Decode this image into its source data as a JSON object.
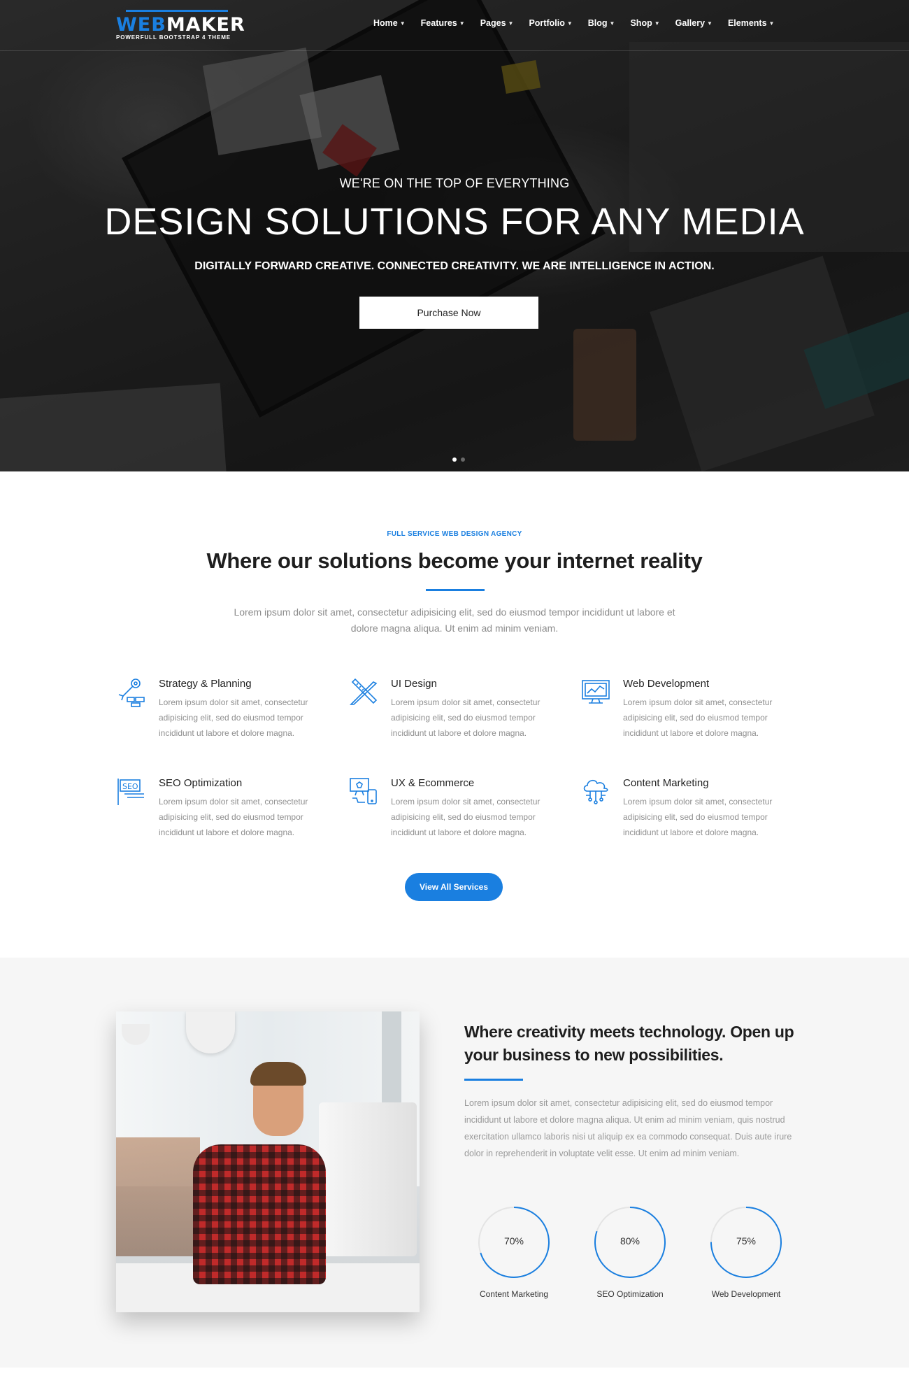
{
  "brand": {
    "name_part1": "WEB",
    "name_part2": "MAKER",
    "tagline": "POWERFULL BOOTSTRAP 4 THEME",
    "accent_color": "#1a7fe0"
  },
  "nav": {
    "items": [
      {
        "label": "Home"
      },
      {
        "label": "Features"
      },
      {
        "label": "Pages"
      },
      {
        "label": "Portfolio"
      },
      {
        "label": "Blog"
      },
      {
        "label": "Shop"
      },
      {
        "label": "Gallery"
      },
      {
        "label": "Elements"
      }
    ],
    "caret_icon": "chevron-down-icon"
  },
  "hero": {
    "kicker": "WE'RE ON THE TOP OF EVERYTHING",
    "title": "DESIGN SOLUTIONS FOR ANY MEDIA",
    "subtitle": "DIGITALLY FORWARD CREATIVE. CONNECTED CREATIVITY. WE ARE INTELLIGENCE IN ACTION.",
    "cta_label": "Purchase Now",
    "slides": 2,
    "active_slide": 1
  },
  "services": {
    "eyebrow": "FULL SERVICE WEB DESIGN AGENCY",
    "title": "Where our solutions become your internet reality",
    "lede": "Lorem ipsum dolor sit amet, consectetur adipisicing elit, sed do eiusmod tempor incididunt ut labore et dolore magna aliqua. Ut enim ad minim veniam.",
    "items": [
      {
        "title": "Strategy & Planning",
        "icon": "strategy-icon",
        "desc": "Lorem ipsum dolor sit amet, consectetur adipisicing elit, sed do eiusmod tempor incididunt ut labore et dolore magna."
      },
      {
        "title": "UI Design",
        "icon": "ui-design-icon",
        "desc": "Lorem ipsum dolor sit amet, consectetur adipisicing elit, sed do eiusmod tempor incididunt ut labore et dolore magna."
      },
      {
        "title": "Web Development",
        "icon": "web-development-icon",
        "desc": "Lorem ipsum dolor sit amet, consectetur adipisicing elit, sed do eiusmod tempor incididunt ut labore et dolore magna."
      },
      {
        "title": "SEO Optimization",
        "icon": "seo-icon",
        "desc": "Lorem ipsum dolor sit amet, consectetur adipisicing elit, sed do eiusmod tempor incididunt ut labore et dolore magna."
      },
      {
        "title": "UX & Ecommerce",
        "icon": "ux-ecommerce-icon",
        "desc": "Lorem ipsum dolor sit amet, consectetur adipisicing elit, sed do eiusmod tempor incididunt ut labore et dolore magna."
      },
      {
        "title": "Content Marketing",
        "icon": "cloud-network-icon",
        "desc": "Lorem ipsum dolor sit amet, consectetur adipisicing elit, sed do eiusmod tempor incididunt ut labore et dolore magna."
      }
    ],
    "cta_label": "View All Services"
  },
  "about": {
    "title": "Where creativity meets technology. Open up your business to new possibilities.",
    "text": "Lorem ipsum dolor sit amet, consectetur adipisicing elit, sed do eiusmod tempor incididunt ut labore et dolore magna aliqua. Ut enim ad minim veniam, quis nostrud exercitation ullamco laboris nisi ut aliquip ex ea commodo consequat. Duis aute irure dolor in reprehenderit in voluptate velit esse. Ut enim ad minim veniam.",
    "stats": [
      {
        "label": "Content Marketing",
        "value_text": "70%",
        "percent": 70
      },
      {
        "label": "SEO Optimization",
        "value_text": "80%",
        "percent": 80
      },
      {
        "label": "Web Development",
        "value_text": "75%",
        "percent": 75
      }
    ]
  }
}
